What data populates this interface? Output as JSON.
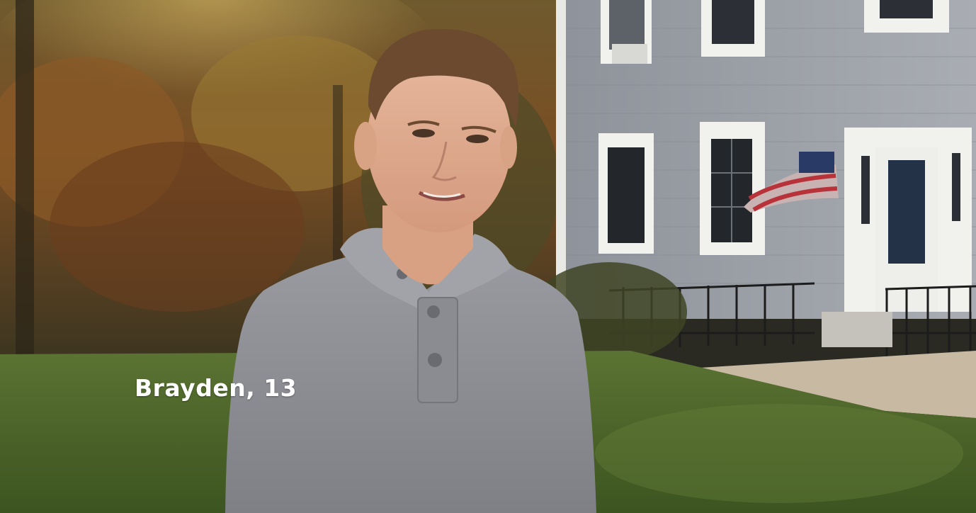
{
  "video_frame": {
    "lower_third": {
      "caption": "Brayden, 13",
      "color": "#ffffff"
    },
    "scene": {
      "subject": "boy-in-grey-henley-hoodie",
      "background": "autumn-trees-and-grey-colonial-house",
      "palette": {
        "foliage": "#8a6a2a",
        "house_siding": "#9a9ea6",
        "trim": "#f1f1ee",
        "grass": "#4f6a2c",
        "hoodie": "#8e8f95"
      }
    }
  }
}
